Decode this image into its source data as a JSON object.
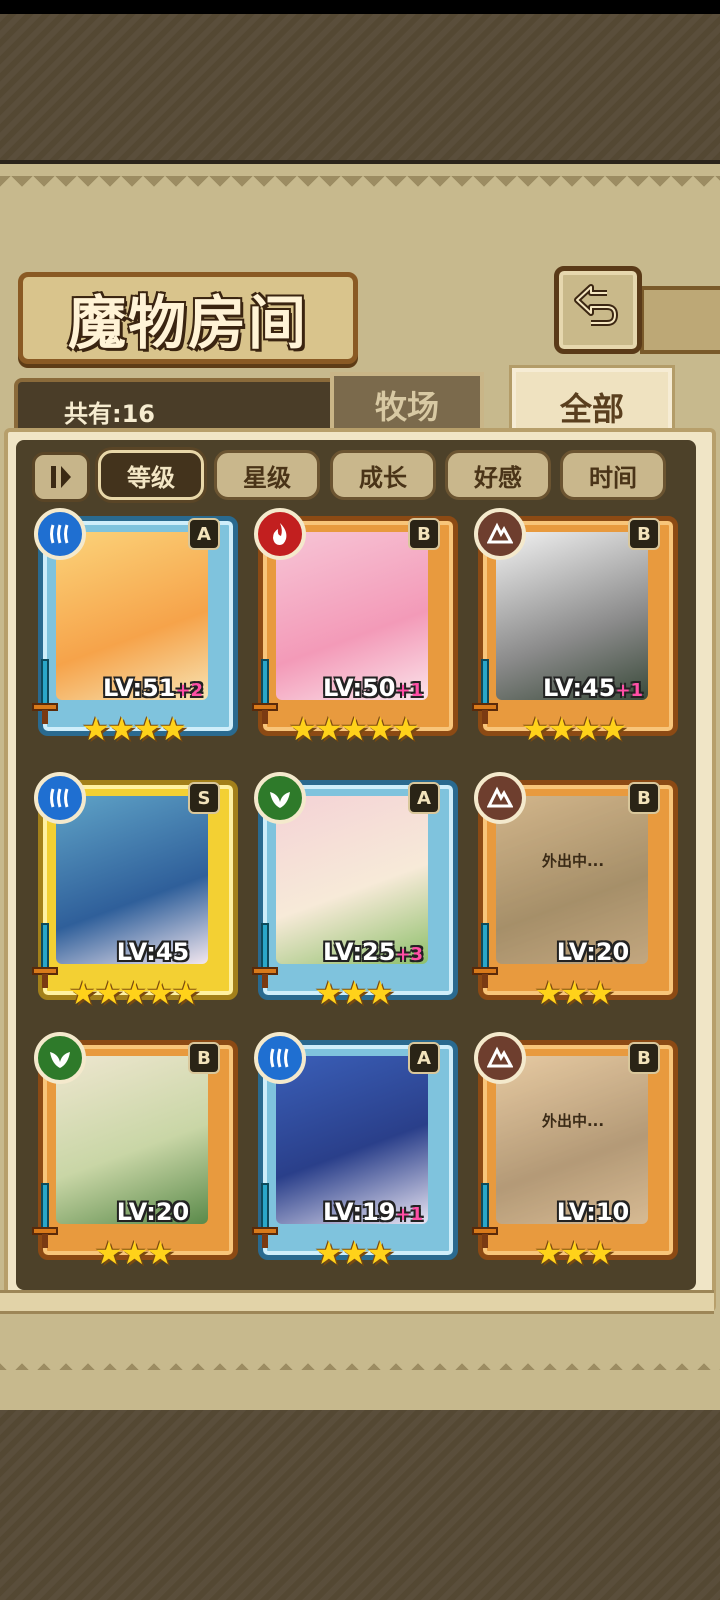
{
  "header": {
    "title": "魔物房间",
    "count_label": "共有:16"
  },
  "tabs": [
    {
      "label": "牧场",
      "active": false
    },
    {
      "label": "全部",
      "active": true
    }
  ],
  "sort_buttons": [
    {
      "label": "等级",
      "active": true
    },
    {
      "label": "星级",
      "active": false
    },
    {
      "label": "成长",
      "active": false
    },
    {
      "label": "好感",
      "active": false
    },
    {
      "label": "时间",
      "active": false
    }
  ],
  "cards": [
    {
      "element": "water",
      "rank": "A",
      "lv": "LV:51",
      "plus": "+2",
      "stars": "★★★★",
      "frame": "blue",
      "status": ""
    },
    {
      "element": "fire",
      "rank": "B",
      "lv": "LV:50",
      "plus": "+1",
      "stars": "★★★★★",
      "frame": "orange",
      "status": ""
    },
    {
      "element": "earth",
      "rank": "B",
      "lv": "LV:45",
      "plus": "+1",
      "stars": "★★★★",
      "frame": "orange",
      "status": ""
    },
    {
      "element": "water",
      "rank": "S",
      "lv": "LV:45",
      "plus": "",
      "stars": "★★★★★",
      "frame": "gold",
      "status": ""
    },
    {
      "element": "plant",
      "rank": "A",
      "lv": "LV:25",
      "plus": "+3",
      "stars": "★★★",
      "frame": "blue",
      "status": ""
    },
    {
      "element": "earth",
      "rank": "B",
      "lv": "LV:20",
      "plus": "",
      "stars": "★★★",
      "frame": "orange",
      "status": "外出中..."
    },
    {
      "element": "plant",
      "rank": "B",
      "lv": "LV:20",
      "plus": "",
      "stars": "★★★",
      "frame": "orange",
      "status": ""
    },
    {
      "element": "water",
      "rank": "A",
      "lv": "LV:19",
      "plus": "+1",
      "stars": "★★★",
      "frame": "blue",
      "status": ""
    },
    {
      "element": "earth",
      "rank": "B",
      "lv": "LV:10",
      "plus": "",
      "stars": "★★★",
      "frame": "orange",
      "status": "外出中..."
    }
  ]
}
